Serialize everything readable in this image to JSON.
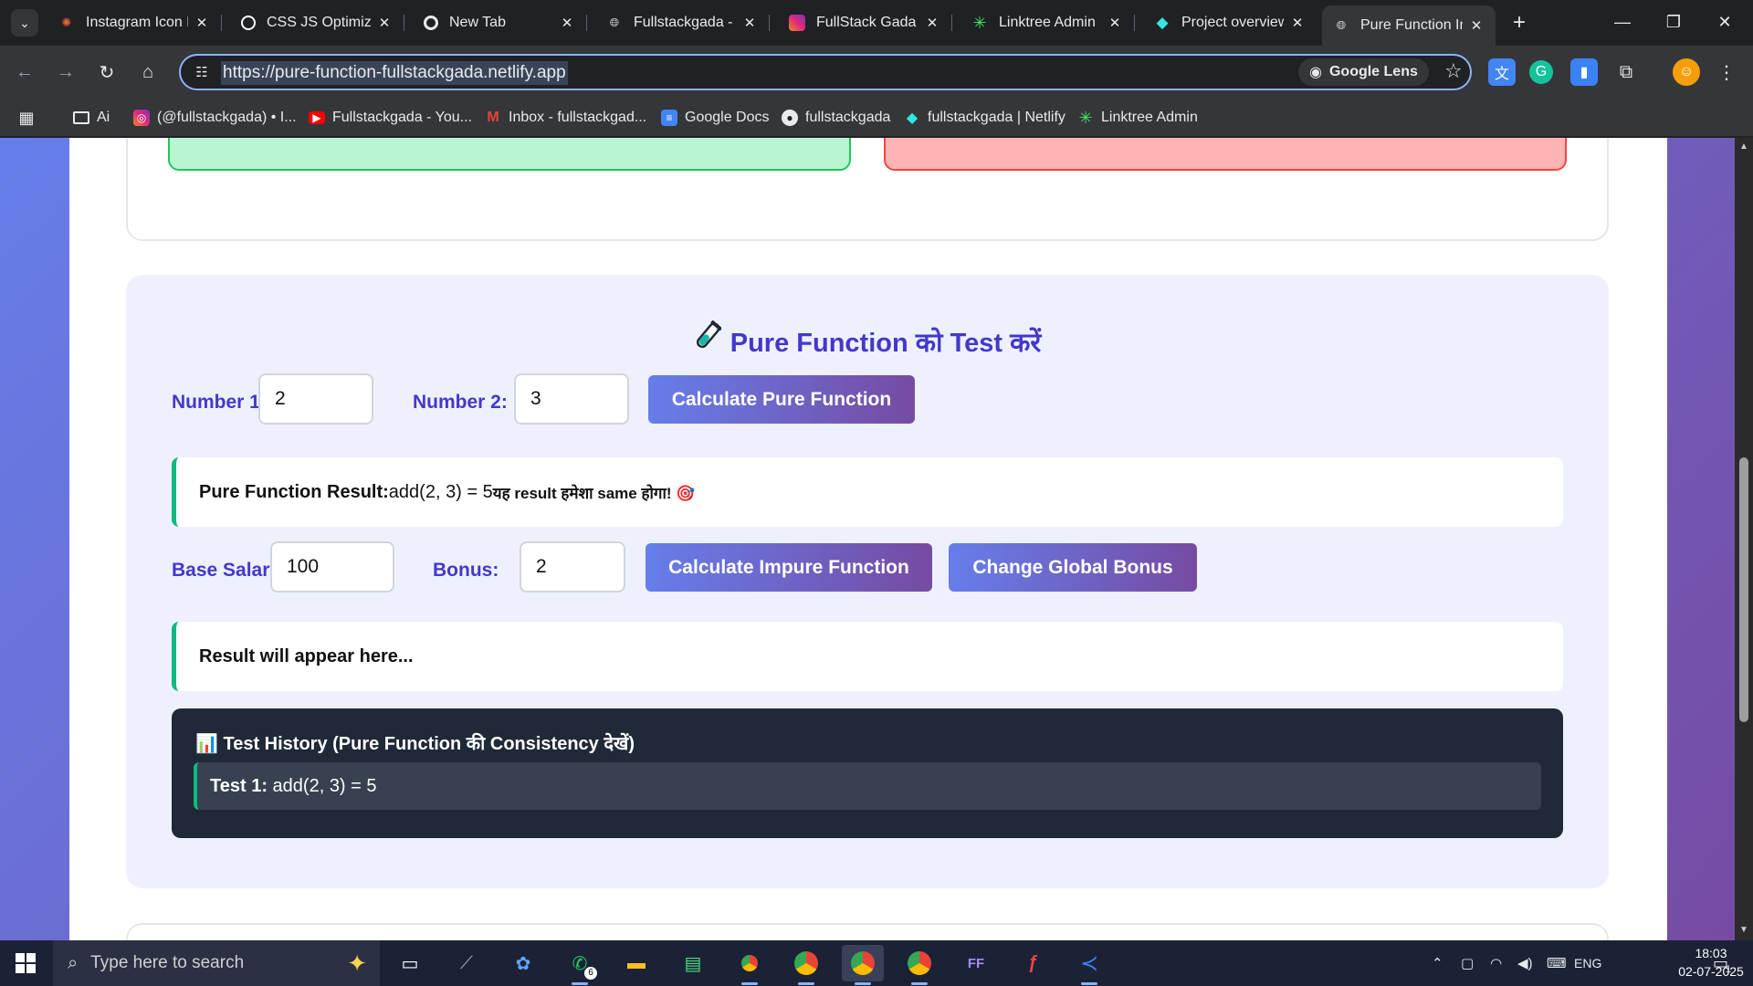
{
  "browser": {
    "tabs": [
      {
        "title": "Instagram Icon H",
        "icon": "asterisk-icon",
        "color": "#e8613c"
      },
      {
        "title": "CSS JS Optimizat",
        "icon": "openai-icon",
        "color": "#ffffff"
      },
      {
        "title": "New Tab",
        "icon": "chrome-icon",
        "color": "#e8eaed"
      },
      {
        "title": "Fullstackgada - F",
        "icon": "globe-icon",
        "color": "#e8eaed"
      },
      {
        "title": "FullStack Gada (",
        "icon": "instagram-icon",
        "color": "#e1306c"
      },
      {
        "title": "Linktree Admin",
        "icon": "linktree-icon",
        "color": "#43e55e"
      },
      {
        "title": "Project overview",
        "icon": "netlify-icon",
        "color": "#32e6e2"
      },
      {
        "title": "Pure Function In",
        "icon": "globe-icon",
        "color": "#e8eaed",
        "active": true
      }
    ],
    "url": "https://pure-function-fullstackgada.netlify.app",
    "lens_label": "Google Lens",
    "bookmarks": [
      {
        "label": "Ai",
        "icon": "folder-icon",
        "color": "#e8eaed"
      },
      {
        "label": "(@fullstackgada) • I...",
        "icon": "instagram-icon",
        "color": "#e1306c"
      },
      {
        "label": "Fullstackgada - You...",
        "icon": "youtube-icon",
        "color": "#ff0000"
      },
      {
        "label": "Inbox - fullstackgad...",
        "icon": "gmail-icon",
        "color": "#ea4335"
      },
      {
        "label": "Google Docs",
        "icon": "docs-icon",
        "color": "#4285f4"
      },
      {
        "label": "fullstackgada",
        "icon": "github-icon",
        "color": "#e8eaed"
      },
      {
        "label": "fullstackgada | Netlify",
        "icon": "netlify-icon",
        "color": "#32e6e2"
      },
      {
        "label": "Linktree Admin",
        "icon": "linktree-icon",
        "color": "#43e55e"
      }
    ]
  },
  "page": {
    "test_title": "Pure Function को Test करें",
    "pure": {
      "num1_label": "Number 1:",
      "num1_value": "2",
      "num2_label": "Number 2:",
      "num2_value": "3",
      "calc_button": "Calculate Pure Function",
      "result_label": "Pure Function Result:",
      "result_value": "add(2, 3) = 5",
      "result_note": "यह result हमेशा same होगा! 🎯"
    },
    "impure": {
      "salary_label": "Base Salary:",
      "salary_value": "100",
      "bonus_label": "Bonus:",
      "bonus_value": "2",
      "calc_button": "Calculate Impure Function",
      "change_button": "Change Global Bonus",
      "result_placeholder": "Result will appear here..."
    },
    "history": {
      "title": "📊 Test History (Pure Function की Consistency देखें)",
      "items": [
        {
          "label": "Test 1:",
          "value": "add(2, 3) = 5"
        }
      ]
    },
    "colors": {
      "accent_start": "#667eea",
      "accent_end": "#764ba2",
      "title": "#4338ca",
      "success": "#10b981"
    }
  },
  "taskbar": {
    "search_placeholder": "Type here to search",
    "whatsapp_badge": "6",
    "tray_lang": "ENG",
    "time": "18:03",
    "date": "02-07-2025",
    "notification_count": "1"
  }
}
